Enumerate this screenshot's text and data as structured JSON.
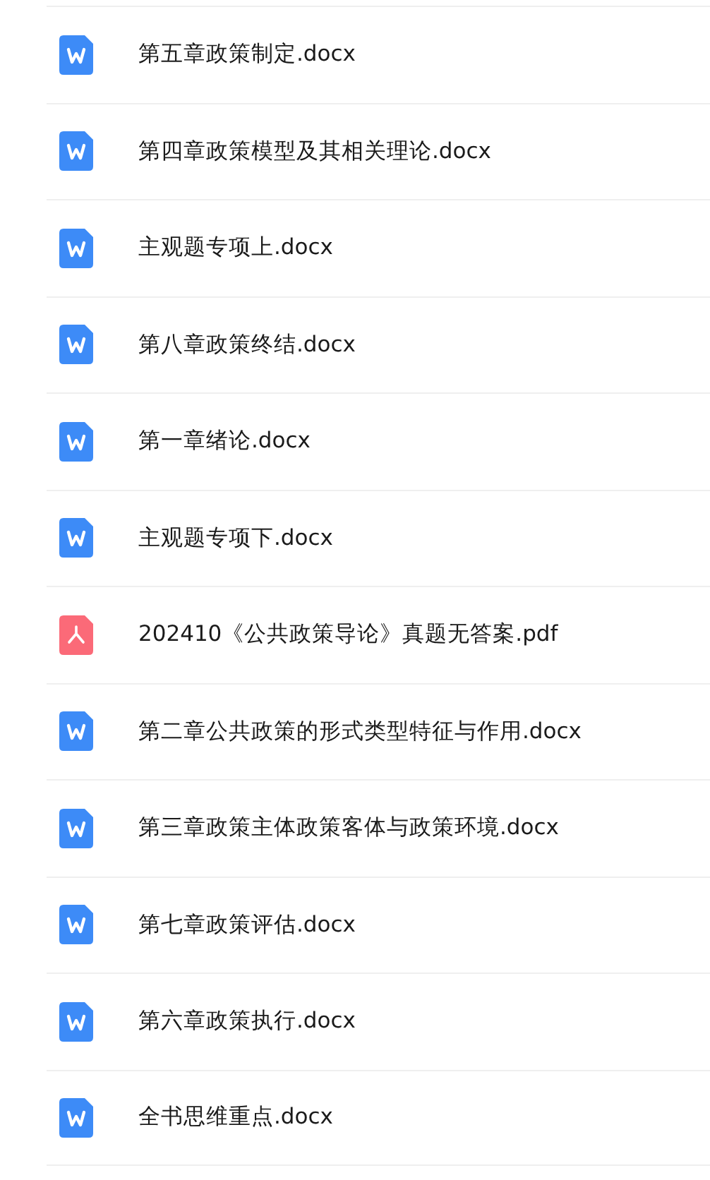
{
  "files": [
    {
      "kind": "word",
      "name": "第五章政策制定.docx"
    },
    {
      "kind": "word",
      "name": "第四章政策模型及其相关理论.docx"
    },
    {
      "kind": "word",
      "name": "主观题专项上.docx"
    },
    {
      "kind": "word",
      "name": "第八章政策终结.docx"
    },
    {
      "kind": "word",
      "name": "第一章绪论.docx"
    },
    {
      "kind": "word",
      "name": "主观题专项下.docx"
    },
    {
      "kind": "pdf",
      "name": "202410《公共政策导论》真题无答案.pdf"
    },
    {
      "kind": "word",
      "name": "第二章公共政策的形式类型特征与作用.docx"
    },
    {
      "kind": "word",
      "name": "第三章政策主体政策客体与政策环境.docx"
    },
    {
      "kind": "word",
      "name": "第七章政策评估.docx"
    },
    {
      "kind": "word",
      "name": "第六章政策执行.docx"
    },
    {
      "kind": "word",
      "name": "全书思维重点.docx"
    }
  ]
}
